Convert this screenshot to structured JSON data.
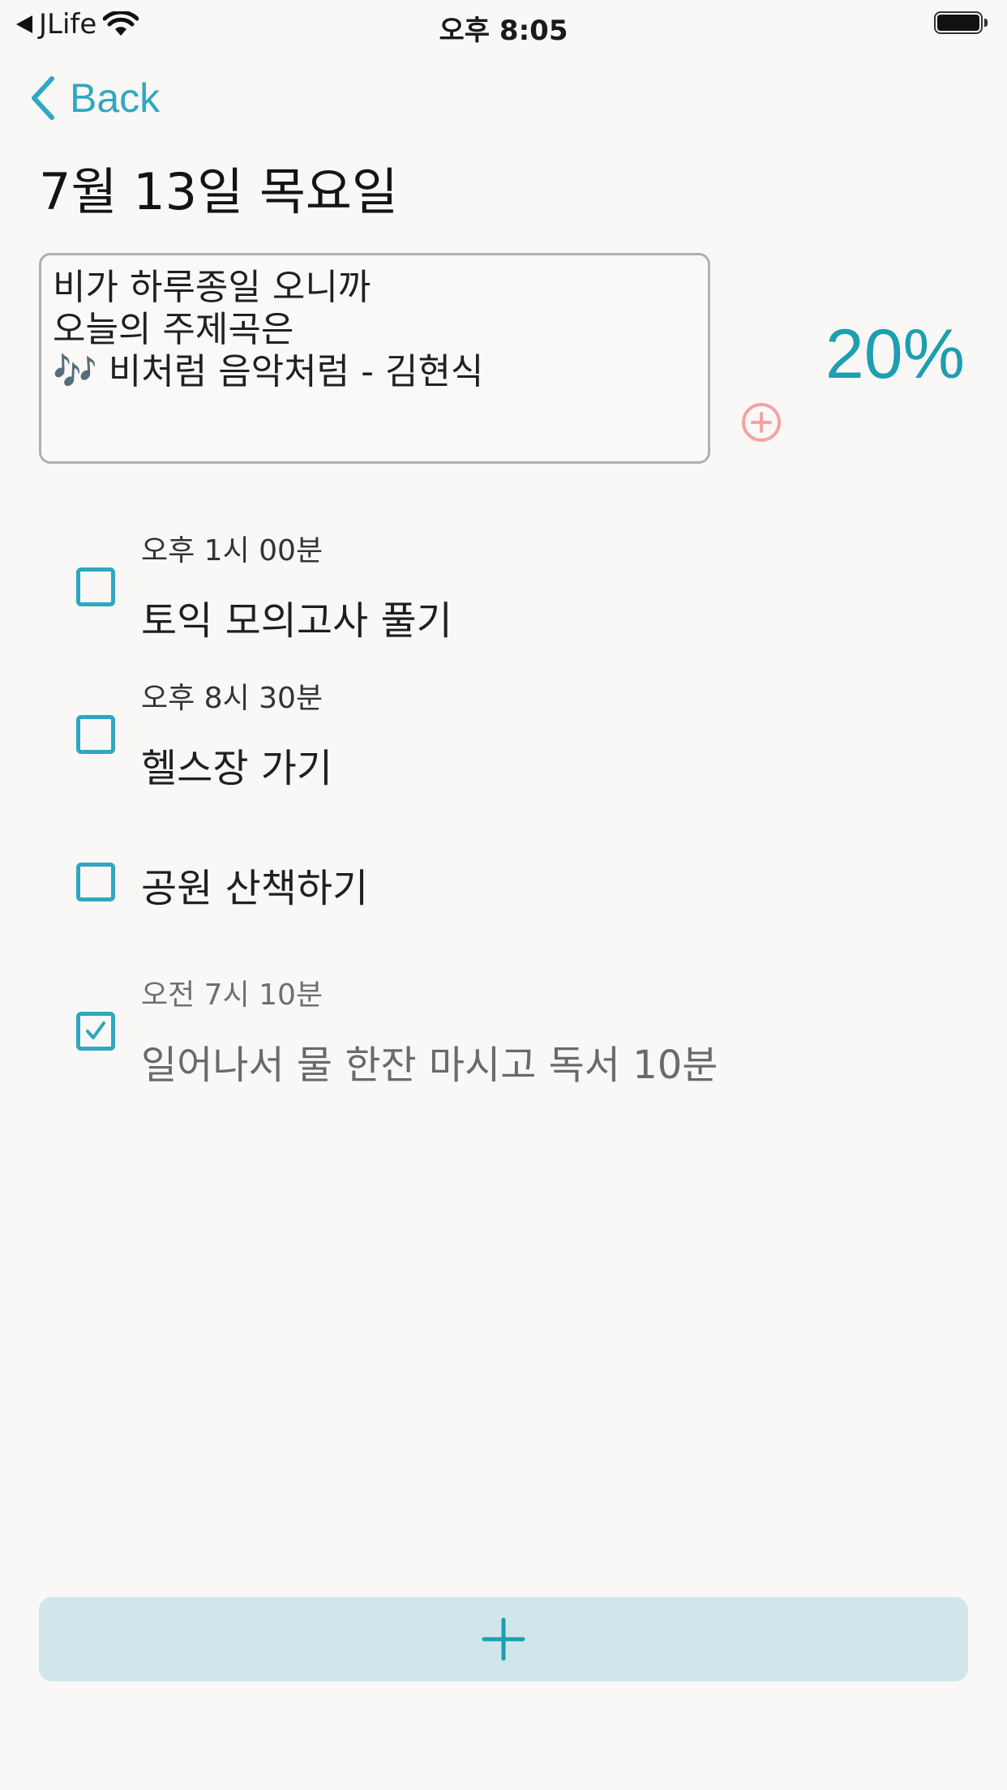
{
  "status_bar": {
    "carrier": "JLife",
    "time": "오후 8:05"
  },
  "nav": {
    "back_label": "Back"
  },
  "page": {
    "title": "7월 13일 목요일"
  },
  "memo": {
    "lines": [
      "비가 하루종일 오니까",
      "오늘의 주제곡은",
      "🎶 비처럼 음악처럼 - 김현식"
    ]
  },
  "progress": {
    "label": "20%",
    "value": 0.2
  },
  "todos": [
    {
      "time": "오후 1시 00분",
      "title": "토익 모의고사 풀기",
      "checked": false
    },
    {
      "time": "오후 8시 30분",
      "title": "헬스장 가기",
      "checked": false
    },
    {
      "time": "",
      "title": "공원 산책하기",
      "checked": false
    },
    {
      "time": "오전 7시 10분",
      "title": "일어나서 물 한잔 마시고 독서 10분",
      "checked": true
    }
  ],
  "colors": {
    "accent": "#2fa8c2",
    "percent": "#1d9fb0",
    "add_memo": "#f4a3a3",
    "add_button_bg": "#cfe7ea",
    "add_button_plus": "#1d9fb0",
    "background": "#f9f8f7"
  },
  "icons": {
    "back": "chevron-left-icon",
    "wifi": "wifi-icon",
    "battery": "battery-icon",
    "add_memo": "plus-circle-icon",
    "add_todo": "plus-icon",
    "checked": "checkmark-icon"
  }
}
